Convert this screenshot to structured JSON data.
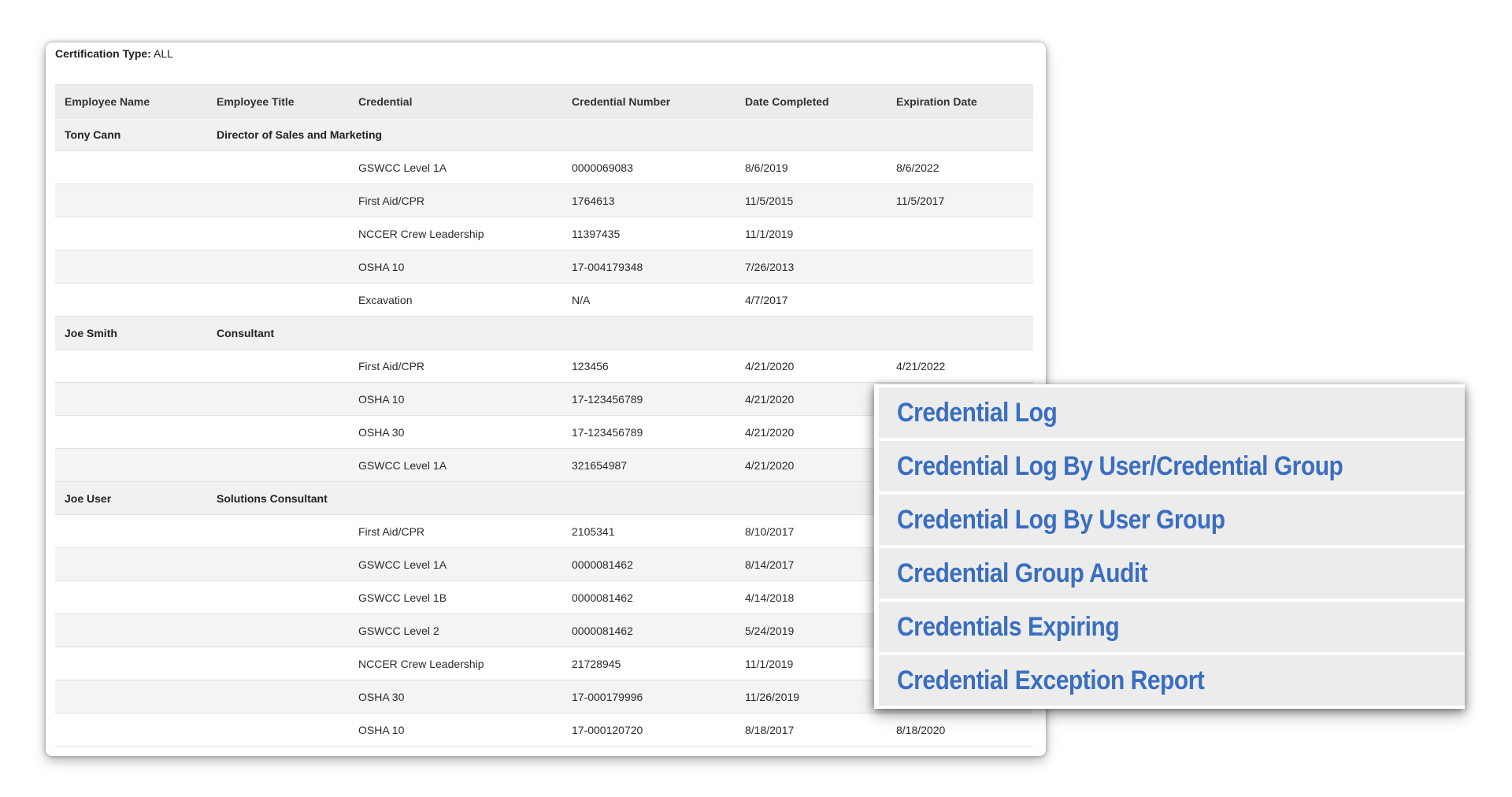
{
  "filter": {
    "label": "Certification Type:",
    "value": "ALL"
  },
  "table": {
    "headers": [
      "Employee Name",
      "Employee Title",
      "Credential",
      "Credential Number",
      "Date Completed",
      "Expiration Date"
    ],
    "rows": [
      {
        "type": "group",
        "cells": [
          "Tony  Cann",
          "Director of Sales and Marketing",
          "",
          "",
          "",
          ""
        ]
      },
      {
        "type": "detail",
        "cells": [
          "",
          "",
          "GSWCC Level 1A",
          "0000069083",
          "8/6/2019",
          "8/6/2022"
        ]
      },
      {
        "type": "detail",
        "cells": [
          "",
          "",
          "First Aid/CPR",
          "1764613",
          "11/5/2015",
          "11/5/2017"
        ]
      },
      {
        "type": "detail",
        "cells": [
          "",
          "",
          "NCCER Crew Leadership",
          "11397435",
          "11/1/2019",
          ""
        ]
      },
      {
        "type": "detail",
        "cells": [
          "",
          "",
          "OSHA 10",
          "17-004179348",
          "7/26/2013",
          ""
        ]
      },
      {
        "type": "detail",
        "cells": [
          "",
          "",
          "Excavation",
          "N/A",
          "4/7/2017",
          ""
        ]
      },
      {
        "type": "group",
        "cells": [
          "Joe Smith",
          "Consultant",
          "",
          "",
          "",
          ""
        ]
      },
      {
        "type": "detail",
        "cells": [
          "",
          "",
          "First Aid/CPR",
          "123456",
          "4/21/2020",
          "4/21/2022"
        ]
      },
      {
        "type": "detail",
        "cells": [
          "",
          "",
          "OSHA 10",
          "17-123456789",
          "4/21/2020",
          ""
        ]
      },
      {
        "type": "detail",
        "cells": [
          "",
          "",
          "OSHA 30",
          "17-123456789",
          "4/21/2020",
          ""
        ]
      },
      {
        "type": "detail",
        "cells": [
          "",
          "",
          "GSWCC Level 1A",
          "321654987",
          "4/21/2020",
          ""
        ]
      },
      {
        "type": "group",
        "cells": [
          "Joe User",
          "Solutions Consultant",
          "",
          "",
          "",
          ""
        ]
      },
      {
        "type": "detail",
        "cells": [
          "",
          "",
          "First Aid/CPR",
          "2105341",
          "8/10/2017",
          ""
        ]
      },
      {
        "type": "detail",
        "cells": [
          "",
          "",
          "GSWCC Level 1A",
          "0000081462",
          "8/14/2017",
          ""
        ]
      },
      {
        "type": "detail",
        "cells": [
          "",
          "",
          "GSWCC Level 1B",
          "0000081462",
          "4/14/2018",
          ""
        ]
      },
      {
        "type": "detail",
        "cells": [
          "",
          "",
          "GSWCC Level 2",
          "0000081462",
          "5/24/2019",
          ""
        ]
      },
      {
        "type": "detail",
        "cells": [
          "",
          "",
          "NCCER Crew Leadership",
          "21728945",
          "11/1/2019",
          ""
        ]
      },
      {
        "type": "detail",
        "cells": [
          "",
          "",
          "OSHA 30",
          "17-000179996",
          "11/26/2019",
          ""
        ]
      },
      {
        "type": "detail",
        "cells": [
          "",
          "",
          "OSHA 10",
          "17-000120720",
          "8/18/2017",
          "8/18/2020"
        ]
      }
    ]
  },
  "menu": {
    "items": [
      "Credential Log",
      "Credential Log By User/Credential Group",
      "Credential Log By User Group",
      "Credential Group Audit",
      "Credentials Expiring",
      "Credential Exception Report"
    ]
  },
  "colors": {
    "menu_text": "#3a6ec1",
    "menu_bg": "#ececec",
    "header_bg": "#ececec"
  }
}
